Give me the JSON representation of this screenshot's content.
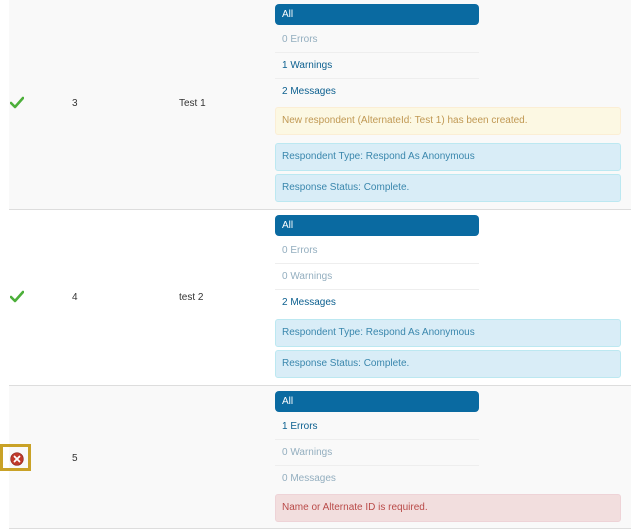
{
  "rows": [
    {
      "status": "success",
      "number": "3",
      "name": "Test 1",
      "filters": [
        {
          "label": "All",
          "state": "active"
        },
        {
          "label": "0 Errors",
          "state": "disabled"
        },
        {
          "label": "1 Warnings",
          "state": "enabled"
        },
        {
          "label": "2 Messages",
          "state": "enabled"
        }
      ],
      "alerts": [
        {
          "type": "warning",
          "text": "New respondent (AlternateId: Test 1) has been created."
        },
        {
          "type": "info",
          "text": "Respondent Type: Respond As Anonymous"
        },
        {
          "type": "info",
          "text": "Response Status: Complete."
        }
      ]
    },
    {
      "status": "success",
      "number": "4",
      "name": "test 2",
      "filters": [
        {
          "label": "All",
          "state": "active"
        },
        {
          "label": "0 Errors",
          "state": "disabled"
        },
        {
          "label": "0 Warnings",
          "state": "disabled"
        },
        {
          "label": "2 Messages",
          "state": "enabled"
        }
      ],
      "alerts": [
        {
          "type": "info",
          "text": "Respondent Type: Respond As Anonymous"
        },
        {
          "type": "info",
          "text": "Response Status: Complete."
        }
      ]
    },
    {
      "status": "error",
      "number": "5",
      "name": "",
      "filters": [
        {
          "label": "All",
          "state": "active"
        },
        {
          "label": "1 Errors",
          "state": "enabled"
        },
        {
          "label": "0 Warnings",
          "state": "disabled"
        },
        {
          "label": "0 Messages",
          "state": "disabled"
        }
      ],
      "alerts": [
        {
          "type": "error",
          "text": "Name or Alternate ID is required."
        }
      ]
    }
  ],
  "colors": {
    "success": "#4caf3a",
    "error": "#c0392b",
    "active_filter": "#0a6aa1",
    "highlight": "#c9a227"
  },
  "icons": {
    "success": "check-icon",
    "error": "error-circle-icon"
  }
}
